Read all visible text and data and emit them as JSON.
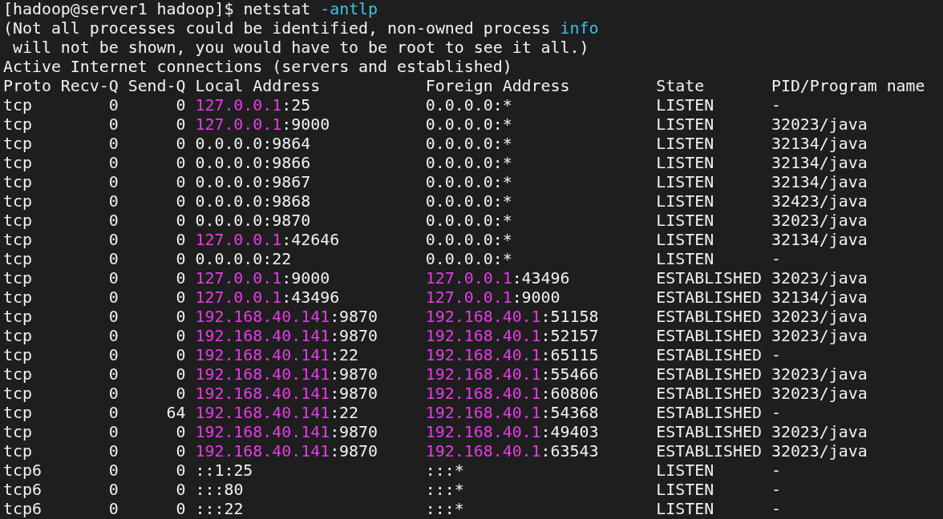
{
  "prompt": {
    "text": "[hadoop@server1 hadoop]$",
    "command": "netstat",
    "option": "-antlp"
  },
  "messages": [
    [
      {
        "text": "(Not all processes could be identified, non-owned process ",
        "highlighted": false
      },
      {
        "text": "info",
        "highlighted": true
      }
    ],
    [
      {
        "text": " will not be shown, you would have to be root to see it all.)",
        "highlighted": false
      }
    ],
    [
      {
        "text": "Active Internet connections (servers and established)",
        "highlighted": false
      }
    ]
  ],
  "table": {
    "columns": [
      "Proto",
      "Recv-Q",
      "Send-Q",
      "Local Address",
      "Foreign Address",
      "State",
      "PID/Program name"
    ],
    "rows": [
      {
        "proto": "tcp",
        "recv_q": "0",
        "send_q": "0",
        "local": {
          "host": "127.0.0.1",
          "port": ":25",
          "highlighted": true
        },
        "foreign": {
          "host": "0.0.0.0",
          "port": ":*",
          "highlighted": false
        },
        "state": "LISTEN",
        "program": "-"
      },
      {
        "proto": "tcp",
        "recv_q": "0",
        "send_q": "0",
        "local": {
          "host": "127.0.0.1",
          "port": ":9000",
          "highlighted": true
        },
        "foreign": {
          "host": "0.0.0.0",
          "port": ":*",
          "highlighted": false
        },
        "state": "LISTEN",
        "program": "32023/java"
      },
      {
        "proto": "tcp",
        "recv_q": "0",
        "send_q": "0",
        "local": {
          "host": "0.0.0.0",
          "port": ":9864",
          "highlighted": false
        },
        "foreign": {
          "host": "0.0.0.0",
          "port": ":*",
          "highlighted": false
        },
        "state": "LISTEN",
        "program": "32134/java"
      },
      {
        "proto": "tcp",
        "recv_q": "0",
        "send_q": "0",
        "local": {
          "host": "0.0.0.0",
          "port": ":9866",
          "highlighted": false
        },
        "foreign": {
          "host": "0.0.0.0",
          "port": ":*",
          "highlighted": false
        },
        "state": "LISTEN",
        "program": "32134/java"
      },
      {
        "proto": "tcp",
        "recv_q": "0",
        "send_q": "0",
        "local": {
          "host": "0.0.0.0",
          "port": ":9867",
          "highlighted": false
        },
        "foreign": {
          "host": "0.0.0.0",
          "port": ":*",
          "highlighted": false
        },
        "state": "LISTEN",
        "program": "32134/java"
      },
      {
        "proto": "tcp",
        "recv_q": "0",
        "send_q": "0",
        "local": {
          "host": "0.0.0.0",
          "port": ":9868",
          "highlighted": false
        },
        "foreign": {
          "host": "0.0.0.0",
          "port": ":*",
          "highlighted": false
        },
        "state": "LISTEN",
        "program": "32423/java"
      },
      {
        "proto": "tcp",
        "recv_q": "0",
        "send_q": "0",
        "local": {
          "host": "0.0.0.0",
          "port": ":9870",
          "highlighted": false
        },
        "foreign": {
          "host": "0.0.0.0",
          "port": ":*",
          "highlighted": false
        },
        "state": "LISTEN",
        "program": "32023/java"
      },
      {
        "proto": "tcp",
        "recv_q": "0",
        "send_q": "0",
        "local": {
          "host": "127.0.0.1",
          "port": ":42646",
          "highlighted": true
        },
        "foreign": {
          "host": "0.0.0.0",
          "port": ":*",
          "highlighted": false
        },
        "state": "LISTEN",
        "program": "32134/java"
      },
      {
        "proto": "tcp",
        "recv_q": "0",
        "send_q": "0",
        "local": {
          "host": "0.0.0.0",
          "port": ":22",
          "highlighted": false
        },
        "foreign": {
          "host": "0.0.0.0",
          "port": ":*",
          "highlighted": false
        },
        "state": "LISTEN",
        "program": "-"
      },
      {
        "proto": "tcp",
        "recv_q": "0",
        "send_q": "0",
        "local": {
          "host": "127.0.0.1",
          "port": ":9000",
          "highlighted": true
        },
        "foreign": {
          "host": "127.0.0.1",
          "port": ":43496",
          "highlighted": true
        },
        "state": "ESTABLISHED",
        "program": "32023/java"
      },
      {
        "proto": "tcp",
        "recv_q": "0",
        "send_q": "0",
        "local": {
          "host": "127.0.0.1",
          "port": ":43496",
          "highlighted": true
        },
        "foreign": {
          "host": "127.0.0.1",
          "port": ":9000",
          "highlighted": true
        },
        "state": "ESTABLISHED",
        "program": "32134/java"
      },
      {
        "proto": "tcp",
        "recv_q": "0",
        "send_q": "0",
        "local": {
          "host": "192.168.40.141",
          "port": ":9870",
          "highlighted": true
        },
        "foreign": {
          "host": "192.168.40.1",
          "port": ":51158",
          "highlighted": true
        },
        "state": "ESTABLISHED",
        "program": "32023/java"
      },
      {
        "proto": "tcp",
        "recv_q": "0",
        "send_q": "0",
        "local": {
          "host": "192.168.40.141",
          "port": ":9870",
          "highlighted": true
        },
        "foreign": {
          "host": "192.168.40.1",
          "port": ":52157",
          "highlighted": true
        },
        "state": "ESTABLISHED",
        "program": "32023/java"
      },
      {
        "proto": "tcp",
        "recv_q": "0",
        "send_q": "0",
        "local": {
          "host": "192.168.40.141",
          "port": ":22",
          "highlighted": true
        },
        "foreign": {
          "host": "192.168.40.1",
          "port": ":65115",
          "highlighted": true
        },
        "state": "ESTABLISHED",
        "program": "-"
      },
      {
        "proto": "tcp",
        "recv_q": "0",
        "send_q": "0",
        "local": {
          "host": "192.168.40.141",
          "port": ":9870",
          "highlighted": true
        },
        "foreign": {
          "host": "192.168.40.1",
          "port": ":55466",
          "highlighted": true
        },
        "state": "ESTABLISHED",
        "program": "32023/java"
      },
      {
        "proto": "tcp",
        "recv_q": "0",
        "send_q": "0",
        "local": {
          "host": "192.168.40.141",
          "port": ":9870",
          "highlighted": true
        },
        "foreign": {
          "host": "192.168.40.1",
          "port": ":60806",
          "highlighted": true
        },
        "state": "ESTABLISHED",
        "program": "32023/java"
      },
      {
        "proto": "tcp",
        "recv_q": "0",
        "send_q": "64",
        "local": {
          "host": "192.168.40.141",
          "port": ":22",
          "highlighted": true
        },
        "foreign": {
          "host": "192.168.40.1",
          "port": ":54368",
          "highlighted": true
        },
        "state": "ESTABLISHED",
        "program": "-"
      },
      {
        "proto": "tcp",
        "recv_q": "0",
        "send_q": "0",
        "local": {
          "host": "192.168.40.141",
          "port": ":9870",
          "highlighted": true
        },
        "foreign": {
          "host": "192.168.40.1",
          "port": ":49403",
          "highlighted": true
        },
        "state": "ESTABLISHED",
        "program": "32023/java"
      },
      {
        "proto": "tcp",
        "recv_q": "0",
        "send_q": "0",
        "local": {
          "host": "192.168.40.141",
          "port": ":9870",
          "highlighted": true
        },
        "foreign": {
          "host": "192.168.40.1",
          "port": ":63543",
          "highlighted": true
        },
        "state": "ESTABLISHED",
        "program": "32023/java"
      },
      {
        "proto": "tcp6",
        "recv_q": "0",
        "send_q": "0",
        "local": {
          "host": "::1",
          "port": ":25",
          "highlighted": false
        },
        "foreign": {
          "host": ":::",
          "port": "*",
          "highlighted": false
        },
        "state": "LISTEN",
        "program": "-"
      },
      {
        "proto": "tcp6",
        "recv_q": "0",
        "send_q": "0",
        "local": {
          "host": ":::",
          "port": "80",
          "highlighted": false
        },
        "foreign": {
          "host": ":::",
          "port": "*",
          "highlighted": false
        },
        "state": "LISTEN",
        "program": "-"
      },
      {
        "proto": "tcp6",
        "recv_q": "0",
        "send_q": "0",
        "local": {
          "host": ":::",
          "port": "22",
          "highlighted": false
        },
        "foreign": {
          "host": ":::",
          "port": "*",
          "highlighted": false
        },
        "state": "LISTEN",
        "program": "-"
      }
    ]
  }
}
